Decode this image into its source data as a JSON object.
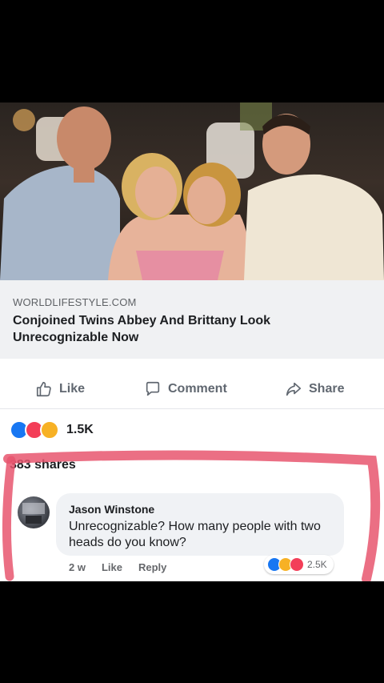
{
  "post": {
    "link": {
      "domain": "WORLDLIFESTYLE.COM",
      "title": "Conjoined Twins Abbey And Brittany Look Unrecognizable Now"
    },
    "actions": [
      {
        "label": "Like",
        "icon": "thumbs-up-icon"
      },
      {
        "label": "Comment",
        "icon": "comment-icon"
      },
      {
        "label": "Share",
        "icon": "share-icon"
      }
    ],
    "reactions": {
      "types": [
        "like",
        "love",
        "wow"
      ],
      "count": "1.5K"
    },
    "shares_text": "383 shares"
  },
  "comment": {
    "author": "Jason Winstone",
    "text": "Unrecognizable? How many people with two heads do you know?",
    "time": "2 w",
    "like_label": "Like",
    "reply_label": "Reply",
    "reactions": {
      "types": [
        "like",
        "haha",
        "love"
      ],
      "count": "2.5K"
    }
  },
  "colors": {
    "facebook_blue": "#1877f2",
    "love_red": "#f33e58",
    "wow_yellow": "#f7b125",
    "marker_pink": "#e8566f"
  }
}
